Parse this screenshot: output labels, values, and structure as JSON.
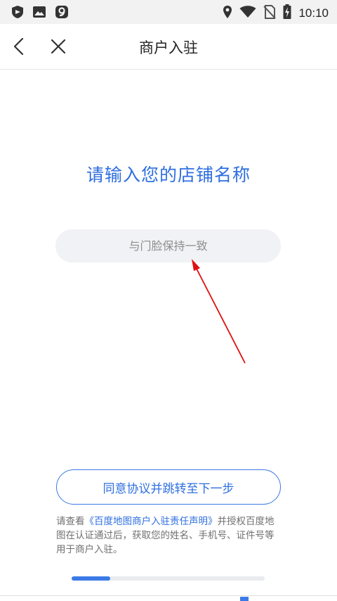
{
  "status_bar": {
    "time": "10:10",
    "icons": [
      "shield-app-icon",
      "image-icon",
      "app-9-icon",
      "location-icon",
      "wifi-icon",
      "no-sim-icon",
      "battery-charging-icon"
    ]
  },
  "header": {
    "title": "商户入驻",
    "back_icon": "chevron-left-icon",
    "close_icon": "close-icon"
  },
  "main": {
    "prompt": "请输入您的店铺名称",
    "name_input": {
      "value": "",
      "placeholder": "与门脸保持一致"
    },
    "submit_label": "同意协议并跳转至下一步",
    "agreement": {
      "prefix": "请查看",
      "link": "《百度地图商户入驻责任声明》",
      "suffix": "并授权百度地图在认证通过后，获取您的姓名、手机号、证件号等用于商户入驻。"
    },
    "progress": {
      "fraction": 0.2
    }
  },
  "colors": {
    "accent": "#2f6fe0",
    "annotation_arrow": "#e01010"
  }
}
